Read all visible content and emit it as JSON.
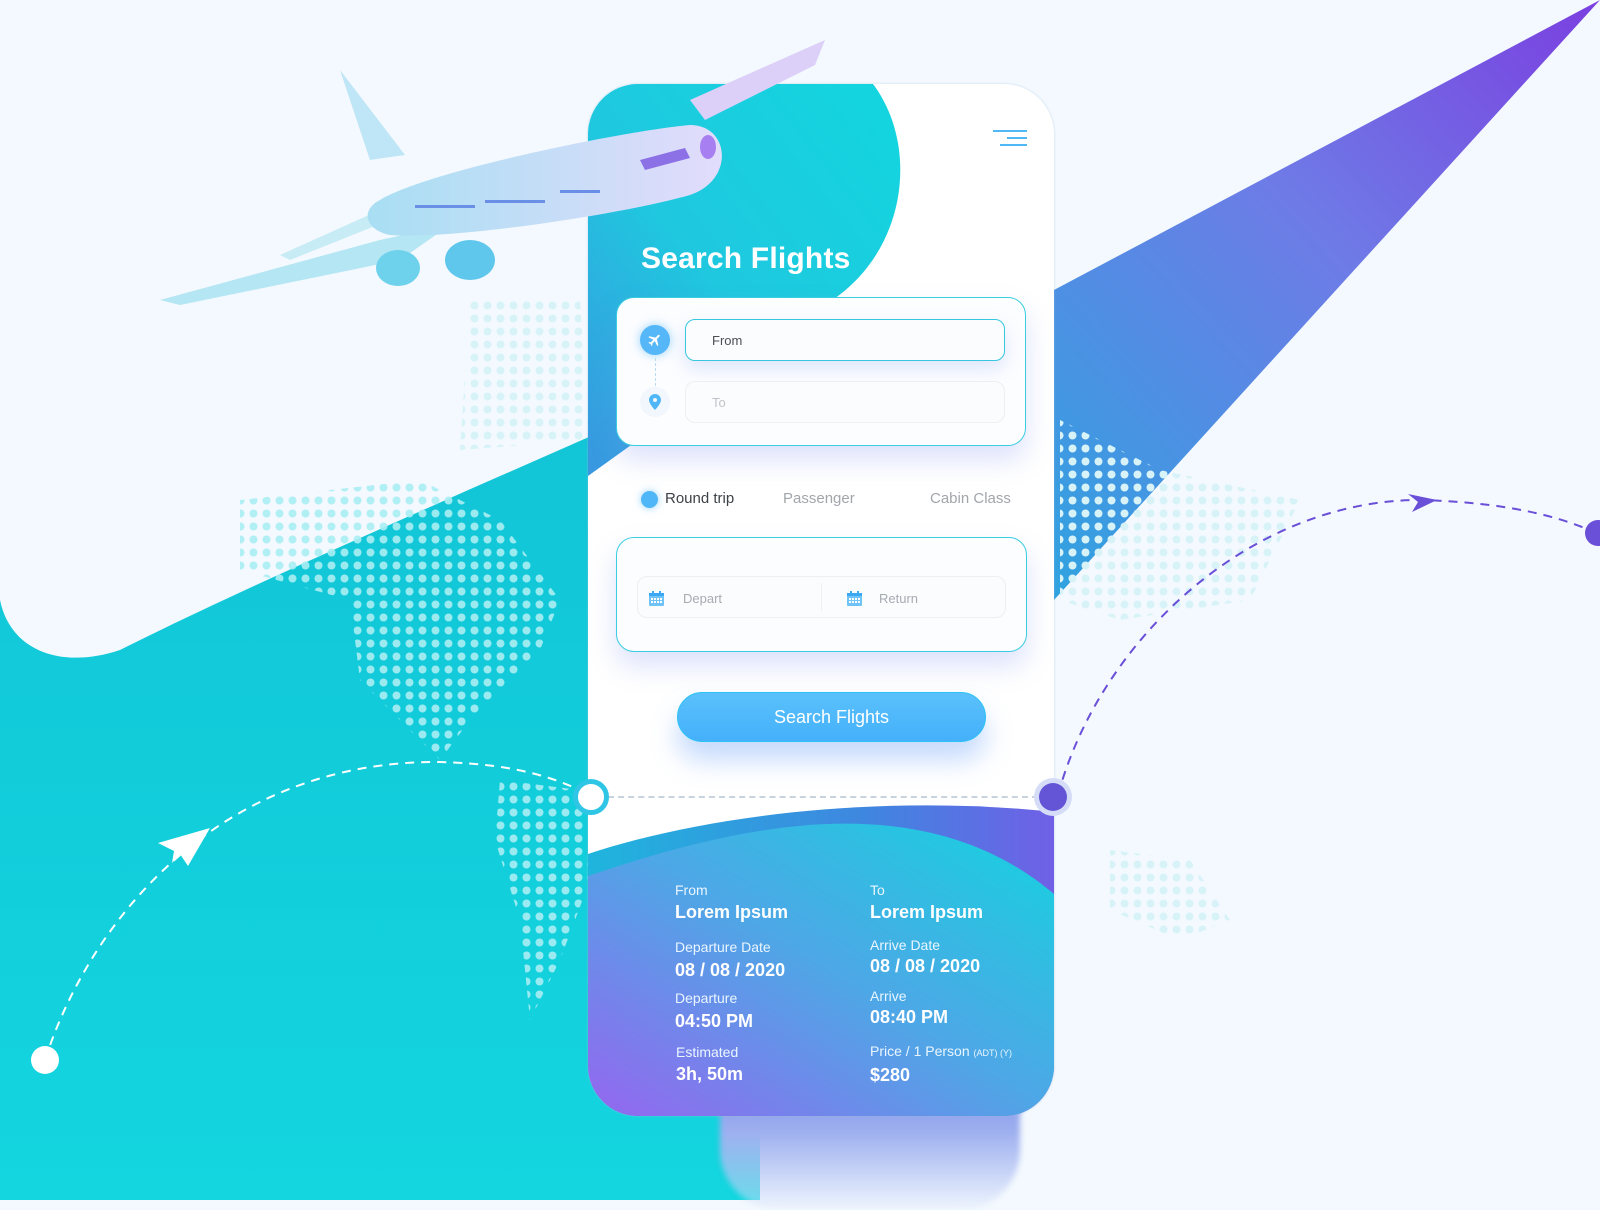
{
  "app": {
    "title": "Search Flights",
    "menu_icon": "hamburger-menu-icon"
  },
  "search": {
    "from_placeholder": "From",
    "to_placeholder": "To",
    "from_icon": "airplane-icon",
    "to_icon": "location-pin-icon"
  },
  "options": {
    "trip_type": "Round trip",
    "trip_type_selected": true,
    "passenger": "Passenger",
    "cabin_class": "Cabin Class"
  },
  "dates": {
    "depart_placeholder": "Depart",
    "return_placeholder": "Return",
    "icon": "calendar-icon"
  },
  "button": {
    "search_label": "Search Flights"
  },
  "summary": {
    "from_label": "From",
    "from_value": "Lorem Ipsum",
    "to_label": "To",
    "to_value": "Lorem Ipsum",
    "departure_date_label": "Departure Date",
    "departure_date_value": "08 / 08 / 2020",
    "arrive_date_label": "Arrive Date",
    "arrive_date_value": "08 / 08 / 2020",
    "departure_label": "Departure",
    "departure_value": "04:50 PM",
    "arrive_label": "Arrive",
    "arrive_value": "08:40 PM",
    "estimated_label": "Estimated",
    "estimated_value": "3h, 50m",
    "price_label": "Price / 1 Person",
    "price_qualifier": "(ADT) (Y)",
    "price_value": "$280"
  },
  "colors": {
    "teal": "#13d6df",
    "blue": "#4fb6f7",
    "purple": "#6b4fd8",
    "background": "#f3f9fe"
  }
}
